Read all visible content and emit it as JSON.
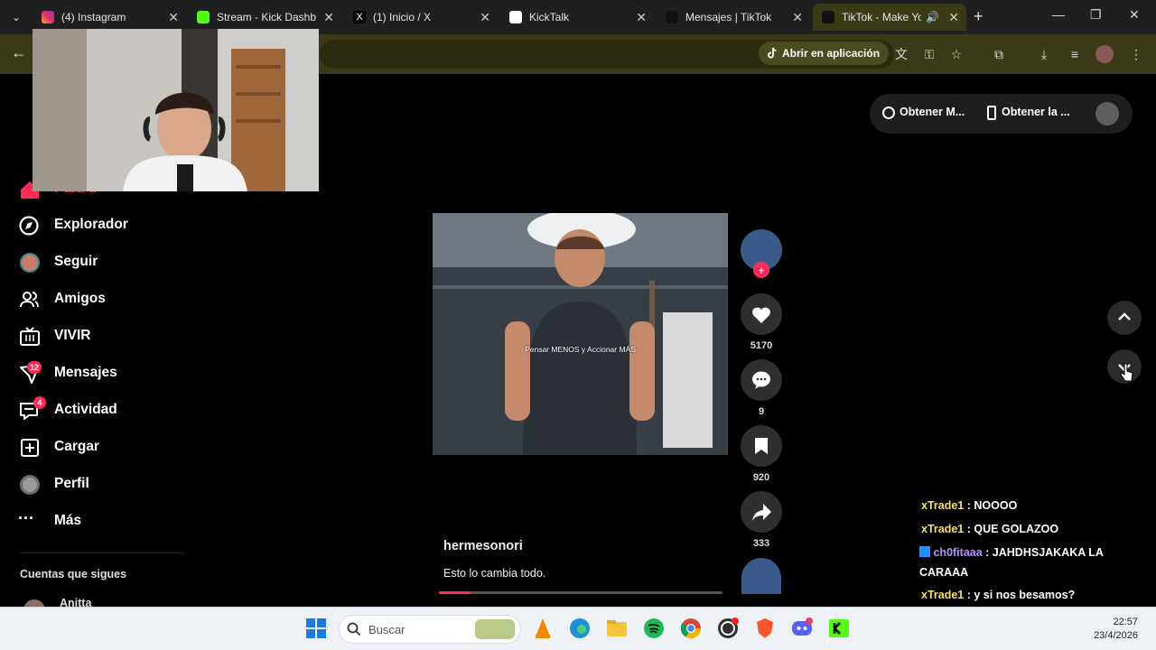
{
  "browser": {
    "tabs": [
      {
        "title": "(4) Instagram",
        "active": false
      },
      {
        "title": "Stream - Kick Dashbo",
        "active": false
      },
      {
        "title": "(1) Inicio / X",
        "active": false
      },
      {
        "title": "KickTalk",
        "active": false
      },
      {
        "title": "Mensajes | TikTok",
        "active": false
      },
      {
        "title": "TikTok - Make Yo",
        "active": true
      }
    ],
    "open_in_app": "Abrir en aplicación"
  },
  "sidebar": {
    "items": [
      {
        "label": "Para ti",
        "icon": "home-icon"
      },
      {
        "label": "Explorador",
        "icon": "compass-icon"
      },
      {
        "label": "Seguir",
        "icon": "following-avatar-icon"
      },
      {
        "label": "Amigos",
        "icon": "friends-icon"
      },
      {
        "label": "VIVIR",
        "icon": "live-icon"
      },
      {
        "label": "Mensajes",
        "icon": "messages-icon",
        "badge": "12"
      },
      {
        "label": "Actividad",
        "icon": "activity-icon",
        "badge": "4"
      },
      {
        "label": "Cargar",
        "icon": "upload-icon"
      },
      {
        "label": "Perfil",
        "icon": "profile-icon"
      },
      {
        "label": "Más",
        "icon": "more-icon"
      }
    ],
    "following_header": "Cuentas que sigues",
    "following": [
      {
        "name": "Anitta"
      }
    ]
  },
  "topright": {
    "coins": "Obtener M...",
    "app": "Obtener la ..."
  },
  "video": {
    "overlay_text": "Pensar MENOS y Accionar MÁS",
    "author": "hermesonori",
    "description": "Esto lo cambia todo.",
    "progress_fraction": 0.11,
    "likes": "5170",
    "comments": "9",
    "saves": "920",
    "shares": "333"
  },
  "chat": [
    {
      "user": "xTrade1",
      "message": "NOOOO"
    },
    {
      "user": "xTrade1",
      "message": "QUE GOLAZOO"
    },
    {
      "user": "ch0fitaaa",
      "message": "JAHDHSJAKAKA LA CARAAA"
    },
    {
      "user": "xTrade1",
      "message": "y si nos besamos?"
    }
  ],
  "taskbar": {
    "search_placeholder": "Buscar",
    "time": "22:57",
    "date": "23/4/2026"
  },
  "colors": {
    "accent": "#fe2c55",
    "browser_theme": "#3a3b16"
  }
}
